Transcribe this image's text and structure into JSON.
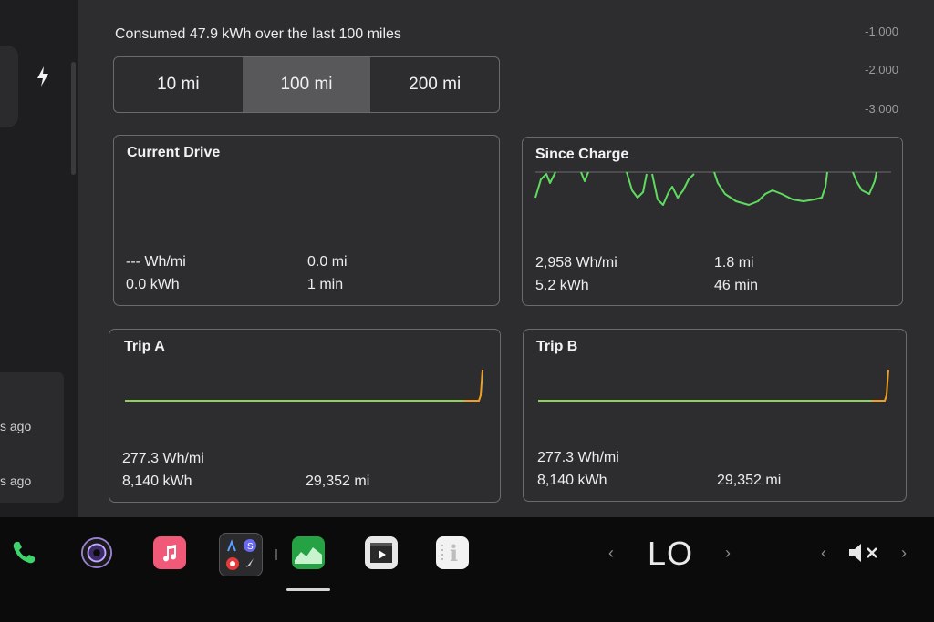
{
  "sidebar": {
    "items": [
      "s ago",
      "s ago"
    ]
  },
  "energy": {
    "consumed_text": "Consumed 47.9 kWh over the last 100 miles",
    "ranges": [
      "10 mi",
      "100 mi",
      "200 mi"
    ],
    "selected_range": "100 mi",
    "y_ticks": [
      "-1,000",
      "-2,000",
      "-3,000"
    ]
  },
  "cards": {
    "current_drive": {
      "title": "Current Drive",
      "efficiency": "--- Wh/mi",
      "energy": "0.0 kWh",
      "distance": "0.0 mi",
      "time": "1 min"
    },
    "since_charge": {
      "title": "Since Charge",
      "efficiency": "2,958 Wh/mi",
      "energy": "5.2 kWh",
      "distance": "1.8 mi",
      "time": "46 min"
    },
    "trip_a": {
      "title": "Trip A",
      "efficiency": "277.3 Wh/mi",
      "energy": "8,140 kWh",
      "distance": "29,352 mi"
    },
    "trip_b": {
      "title": "Trip B",
      "efficiency": "277.3 Wh/mi",
      "energy": "8,140 kWh",
      "distance": "29,352 mi"
    }
  },
  "dock": {
    "apps": [
      "phone-icon",
      "camera-icon",
      "music-icon",
      "app-launcher-icon",
      "energy-app-icon",
      "theater-icon",
      "manual-icon"
    ],
    "temperature": "LO",
    "volume": "muted",
    "colors": {
      "accent_green": "#5fdc5f",
      "trip_orange": "#f0a020"
    }
  }
}
